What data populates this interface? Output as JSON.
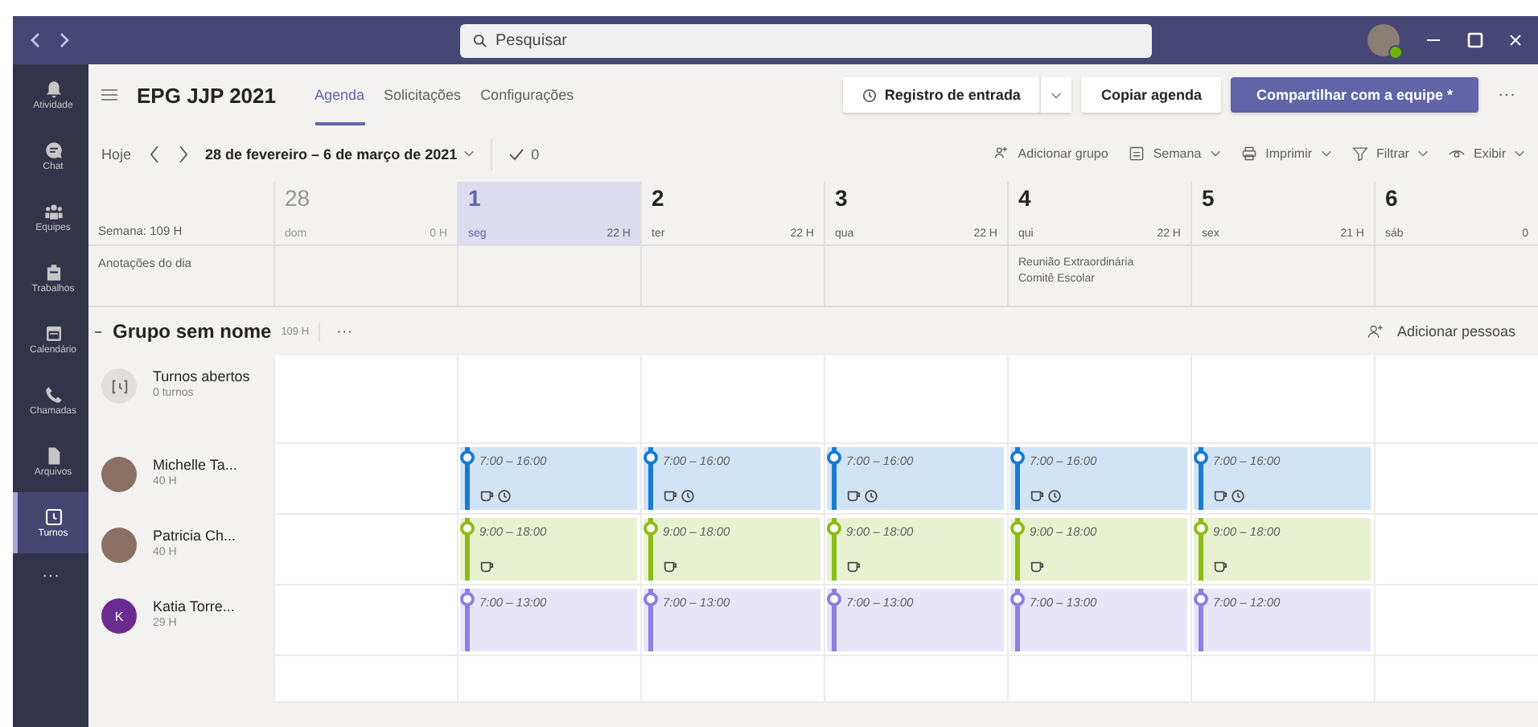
{
  "titlebar": {
    "search_placeholder": "Pesquisar"
  },
  "rail": [
    {
      "kind": "bell",
      "label": "Atividade",
      "selected": false
    },
    {
      "kind": "chat",
      "label": "Chat",
      "selected": false
    },
    {
      "kind": "team",
      "label": "Equipes",
      "selected": false
    },
    {
      "kind": "bag",
      "label": "Trabalhos",
      "selected": false
    },
    {
      "kind": "calendar",
      "label": "Calendário",
      "selected": false
    },
    {
      "kind": "phone",
      "label": "Chamadas",
      "selected": false
    },
    {
      "kind": "file",
      "label": "Arquivos",
      "selected": false
    },
    {
      "kind": "shifts",
      "label": "Turnos",
      "selected": true
    }
  ],
  "rail_more": "···",
  "header": {
    "title": "EPG JJP 2021",
    "tabs": [
      {
        "label": "Agenda",
        "selected": true
      },
      {
        "label": "Solicitações",
        "selected": false
      },
      {
        "label": "Configurações",
        "selected": false
      }
    ],
    "clock_in": "Registro de entrada",
    "copy": "Copiar agenda",
    "share": "Compartilhar com a equipe *",
    "more": "···"
  },
  "toolbar": {
    "today": "Hoje",
    "range": "28 de fevereiro – 6 de março de 2021",
    "approved": "0",
    "actions": [
      {
        "kind": "group",
        "label": "Adicionar grupo",
        "dropdown": false
      },
      {
        "kind": "week",
        "label": "Semana",
        "dropdown": true
      },
      {
        "kind": "print",
        "label": "Imprimir",
        "dropdown": true
      },
      {
        "kind": "filter",
        "label": "Filtrar",
        "dropdown": true
      },
      {
        "kind": "view",
        "label": "Exibir",
        "dropdown": true
      }
    ]
  },
  "week_total": "Semana: 109 H",
  "notes_label": "Anotações do dia",
  "days": [
    {
      "number": "28",
      "weekday": "dom",
      "hours": "0 H",
      "selected": false,
      "disabled": true
    },
    {
      "number": "1",
      "weekday": "seg",
      "hours": "22 H",
      "selected": true,
      "disabled": false
    },
    {
      "number": "2",
      "weekday": "ter",
      "hours": "22 H",
      "selected": false,
      "disabled": false
    },
    {
      "number": "3",
      "weekday": "qua",
      "hours": "22 H",
      "selected": false,
      "disabled": false
    },
    {
      "number": "4",
      "weekday": "qui",
      "hours": "22 H",
      "selected": false,
      "disabled": false,
      "note": [
        "Reunião Extraordinária",
        "Comitê Escolar"
      ]
    },
    {
      "number": "5",
      "weekday": "sex",
      "hours": "21 H",
      "selected": false,
      "disabled": false
    },
    {
      "number": "6",
      "weekday": "sáb",
      "hours": "0",
      "selected": false,
      "disabled": false
    }
  ],
  "group": {
    "name": "Grupo sem nome",
    "hours": "109 H",
    "more": "···",
    "add_people": "Adicionar pessoas"
  },
  "open_shifts": {
    "title": "Turnos abertos",
    "count": "0 turnos"
  },
  "people": [
    {
      "name": "Michelle Ta...",
      "hours": "40 H",
      "kind": "photo",
      "color": "#1a7ad4",
      "shifts": [
        {
          "kind": "empty"
        },
        {
          "kind": "shift",
          "time": "7:00 – 16:00",
          "break": true,
          "clock": true
        },
        {
          "kind": "shift",
          "time": "7:00 – 16:00",
          "break": true,
          "clock": true
        },
        {
          "kind": "shift",
          "time": "7:00 – 16:00",
          "break": true,
          "clock": true
        },
        {
          "kind": "shift",
          "time": "7:00 – 16:00",
          "break": true,
          "clock": true
        },
        {
          "kind": "shift",
          "time": "7:00 – 16:00",
          "break": true,
          "clock": true
        },
        {
          "kind": "empty"
        }
      ]
    },
    {
      "name": "Patricia Ch...",
      "hours": "40 H",
      "kind": "photo",
      "color": "#8cbd18",
      "shifts": [
        {
          "kind": "empty"
        },
        {
          "kind": "shift",
          "time": "9:00 – 18:00",
          "break": true,
          "clock": false
        },
        {
          "kind": "shift",
          "time": "9:00 – 18:00",
          "break": true,
          "clock": false
        },
        {
          "kind": "shift",
          "time": "9:00 – 18:00",
          "break": true,
          "clock": false
        },
        {
          "kind": "shift",
          "time": "9:00 – 18:00",
          "break": true,
          "clock": false
        },
        {
          "kind": "shift",
          "time": "9:00 – 18:00",
          "break": true,
          "clock": false
        },
        {
          "kind": "empty"
        }
      ]
    },
    {
      "name": "Katia Torre...",
      "hours": "29 H",
      "kind": "initial",
      "initial": "K",
      "color": "#8f7fe0",
      "shifts": [
        {
          "kind": "empty"
        },
        {
          "kind": "shift",
          "time": "7:00 – 13:00",
          "break": false,
          "clock": false
        },
        {
          "kind": "shift",
          "time": "7:00 – 13:00",
          "break": false,
          "clock": false
        },
        {
          "kind": "shift",
          "time": "7:00 – 13:00",
          "break": false,
          "clock": false
        },
        {
          "kind": "shift",
          "time": "7:00 – 13:00",
          "break": false,
          "clock": false
        },
        {
          "kind": "shift",
          "time": "7:00 – 12:00",
          "break": false,
          "clock": false
        },
        {
          "kind": "empty"
        }
      ]
    }
  ]
}
